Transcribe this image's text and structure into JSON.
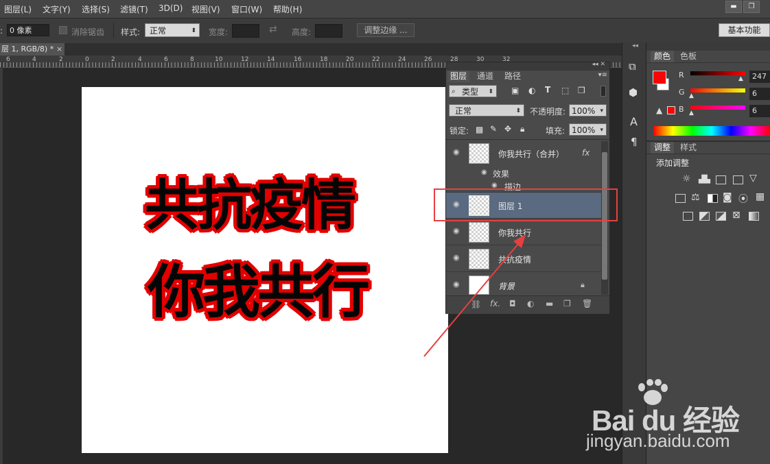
{
  "menubar": {
    "items": [
      "图层(L)",
      "文字(Y)",
      "选择(S)",
      "滤镜(T)",
      "3D(D)",
      "视图(V)",
      "窗口(W)",
      "帮助(H)"
    ],
    "minimize": "▬",
    "restore": "❐"
  },
  "options": {
    "feather_value": "0 像素",
    "antialias_label": "消除锯齿",
    "style_label": "样式:",
    "style_value": "正常",
    "width_label": "宽度:",
    "height_label": "高度:",
    "refine_edge_button": "调整边缘 ...",
    "workspace_button": "基本功能"
  },
  "document": {
    "tab_title": "层 1, RGB/8) *",
    "close": "×"
  },
  "ruler": {
    "labels": [
      "6",
      "4",
      "2",
      "0",
      "2",
      "4",
      "6",
      "8",
      "10",
      "12",
      "14",
      "16",
      "18",
      "20",
      "22",
      "24",
      "26",
      "28",
      "30",
      "32"
    ]
  },
  "canvas": {
    "line1": "共抗疫情",
    "line2": "你我共行"
  },
  "layers_panel": {
    "tabs": [
      "图层",
      "通道",
      "路径"
    ],
    "filter_kind": "类型",
    "blend_mode": "正常",
    "opacity_label": "不透明度:",
    "opacity_value": "100%",
    "lock_label": "锁定:",
    "fill_label": "填充:",
    "fill_value": "100%",
    "layers": [
      {
        "name": "你我共行（合并）",
        "fx": "fx"
      },
      {
        "name": "图层 1"
      },
      {
        "name": "你我共行"
      },
      {
        "name": "共抗疫情"
      },
      {
        "name": "背景"
      }
    ],
    "effects_label": "效果",
    "stroke_label": "描边",
    "bottom_icons": [
      "link-icon",
      "fx-icon",
      "mask-icon",
      "adjustment-icon",
      "folder-icon",
      "new-layer-icon",
      "trash-icon"
    ]
  },
  "color_panel": {
    "tabs": [
      "颜色",
      "色板"
    ],
    "r_label": "R",
    "r_value": "247",
    "g_label": "G",
    "g_value": "6",
    "b_label": "B",
    "b_value": "6",
    "foreground": "#f70606"
  },
  "adjust_panel": {
    "tabs": [
      "调整",
      "样式"
    ],
    "add_label": "添加调整"
  },
  "watermark": {
    "brand": "Bai  du 经验",
    "url": "jingyan.baidu.com"
  }
}
